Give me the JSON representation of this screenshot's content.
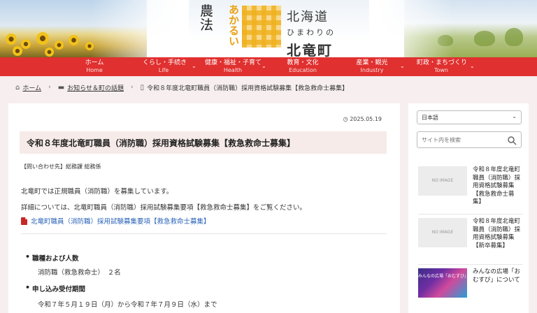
{
  "header": {
    "logo_kanji": "農法",
    "logo_kana": "あかるい",
    "logo_line1": "北海道",
    "logo_line2": "ひまわりの",
    "logo_line3": "北竜町"
  },
  "nav": [
    {
      "label": "ホーム",
      "sub": "Home",
      "dropdown": false
    },
    {
      "label": "くらし・手続き",
      "sub": "Life",
      "dropdown": true
    },
    {
      "label": "健康・福祉・子育て",
      "sub": "Health",
      "dropdown": true
    },
    {
      "label": "教育・文化",
      "sub": "Education",
      "dropdown": false
    },
    {
      "label": "産業・観光",
      "sub": "Industry",
      "dropdown": true
    },
    {
      "label": "町政・まちづくり",
      "sub": "Town",
      "dropdown": true
    }
  ],
  "breadcrumb": {
    "home": "ホーム",
    "category": "お知らせ＆町の話題",
    "current": "令和８年度北竜町職員（消防職）採用資格試験募集【救急救命士募集】"
  },
  "article": {
    "date": "2025.05.19",
    "title": "令和８年度北竜町職員（消防職）採用資格試験募集【救急救命士募集】",
    "contact": "【問い合わせ先】総務課 総務係",
    "p1": "北竜町では正規職員（消防職）を募集しています。",
    "p2": "詳細については、北竜町職員（消防職）採用試験募集要項【救急救命士募集】をご覧ください。",
    "pdf_link": "北竜町職員（消防職）採用試験募集要項【救急救命士募集】",
    "items": [
      {
        "heading": "職種および人数",
        "value": "消防職（救急救命士）　２名"
      },
      {
        "heading": "申し込み受付期間",
        "value": "令和７年５月１９日（月）から令和７年７月９日（水）まで"
      }
    ]
  },
  "sidebar": {
    "language": "日本語",
    "search_placeholder": "サイト内を検索",
    "posts": [
      {
        "thumb": "NO IMAGE",
        "title": "令和８年度北竜町職員（消防職）採用資格試験募集【救急救命士募集】"
      },
      {
        "thumb": "NO IMAGE",
        "title": "令和８年度北竜町職員（消防職）採用資格試験募集【新卒募集】"
      },
      {
        "thumb": "みんなの広場「おむすび」",
        "title": "みんなの広場「おむすび」について"
      }
    ]
  },
  "colors": {
    "nav_red": "#e0302f",
    "link_blue": "#2a63b8",
    "title_bg": "#f6ebe8",
    "page_bg": "#f7efef"
  }
}
